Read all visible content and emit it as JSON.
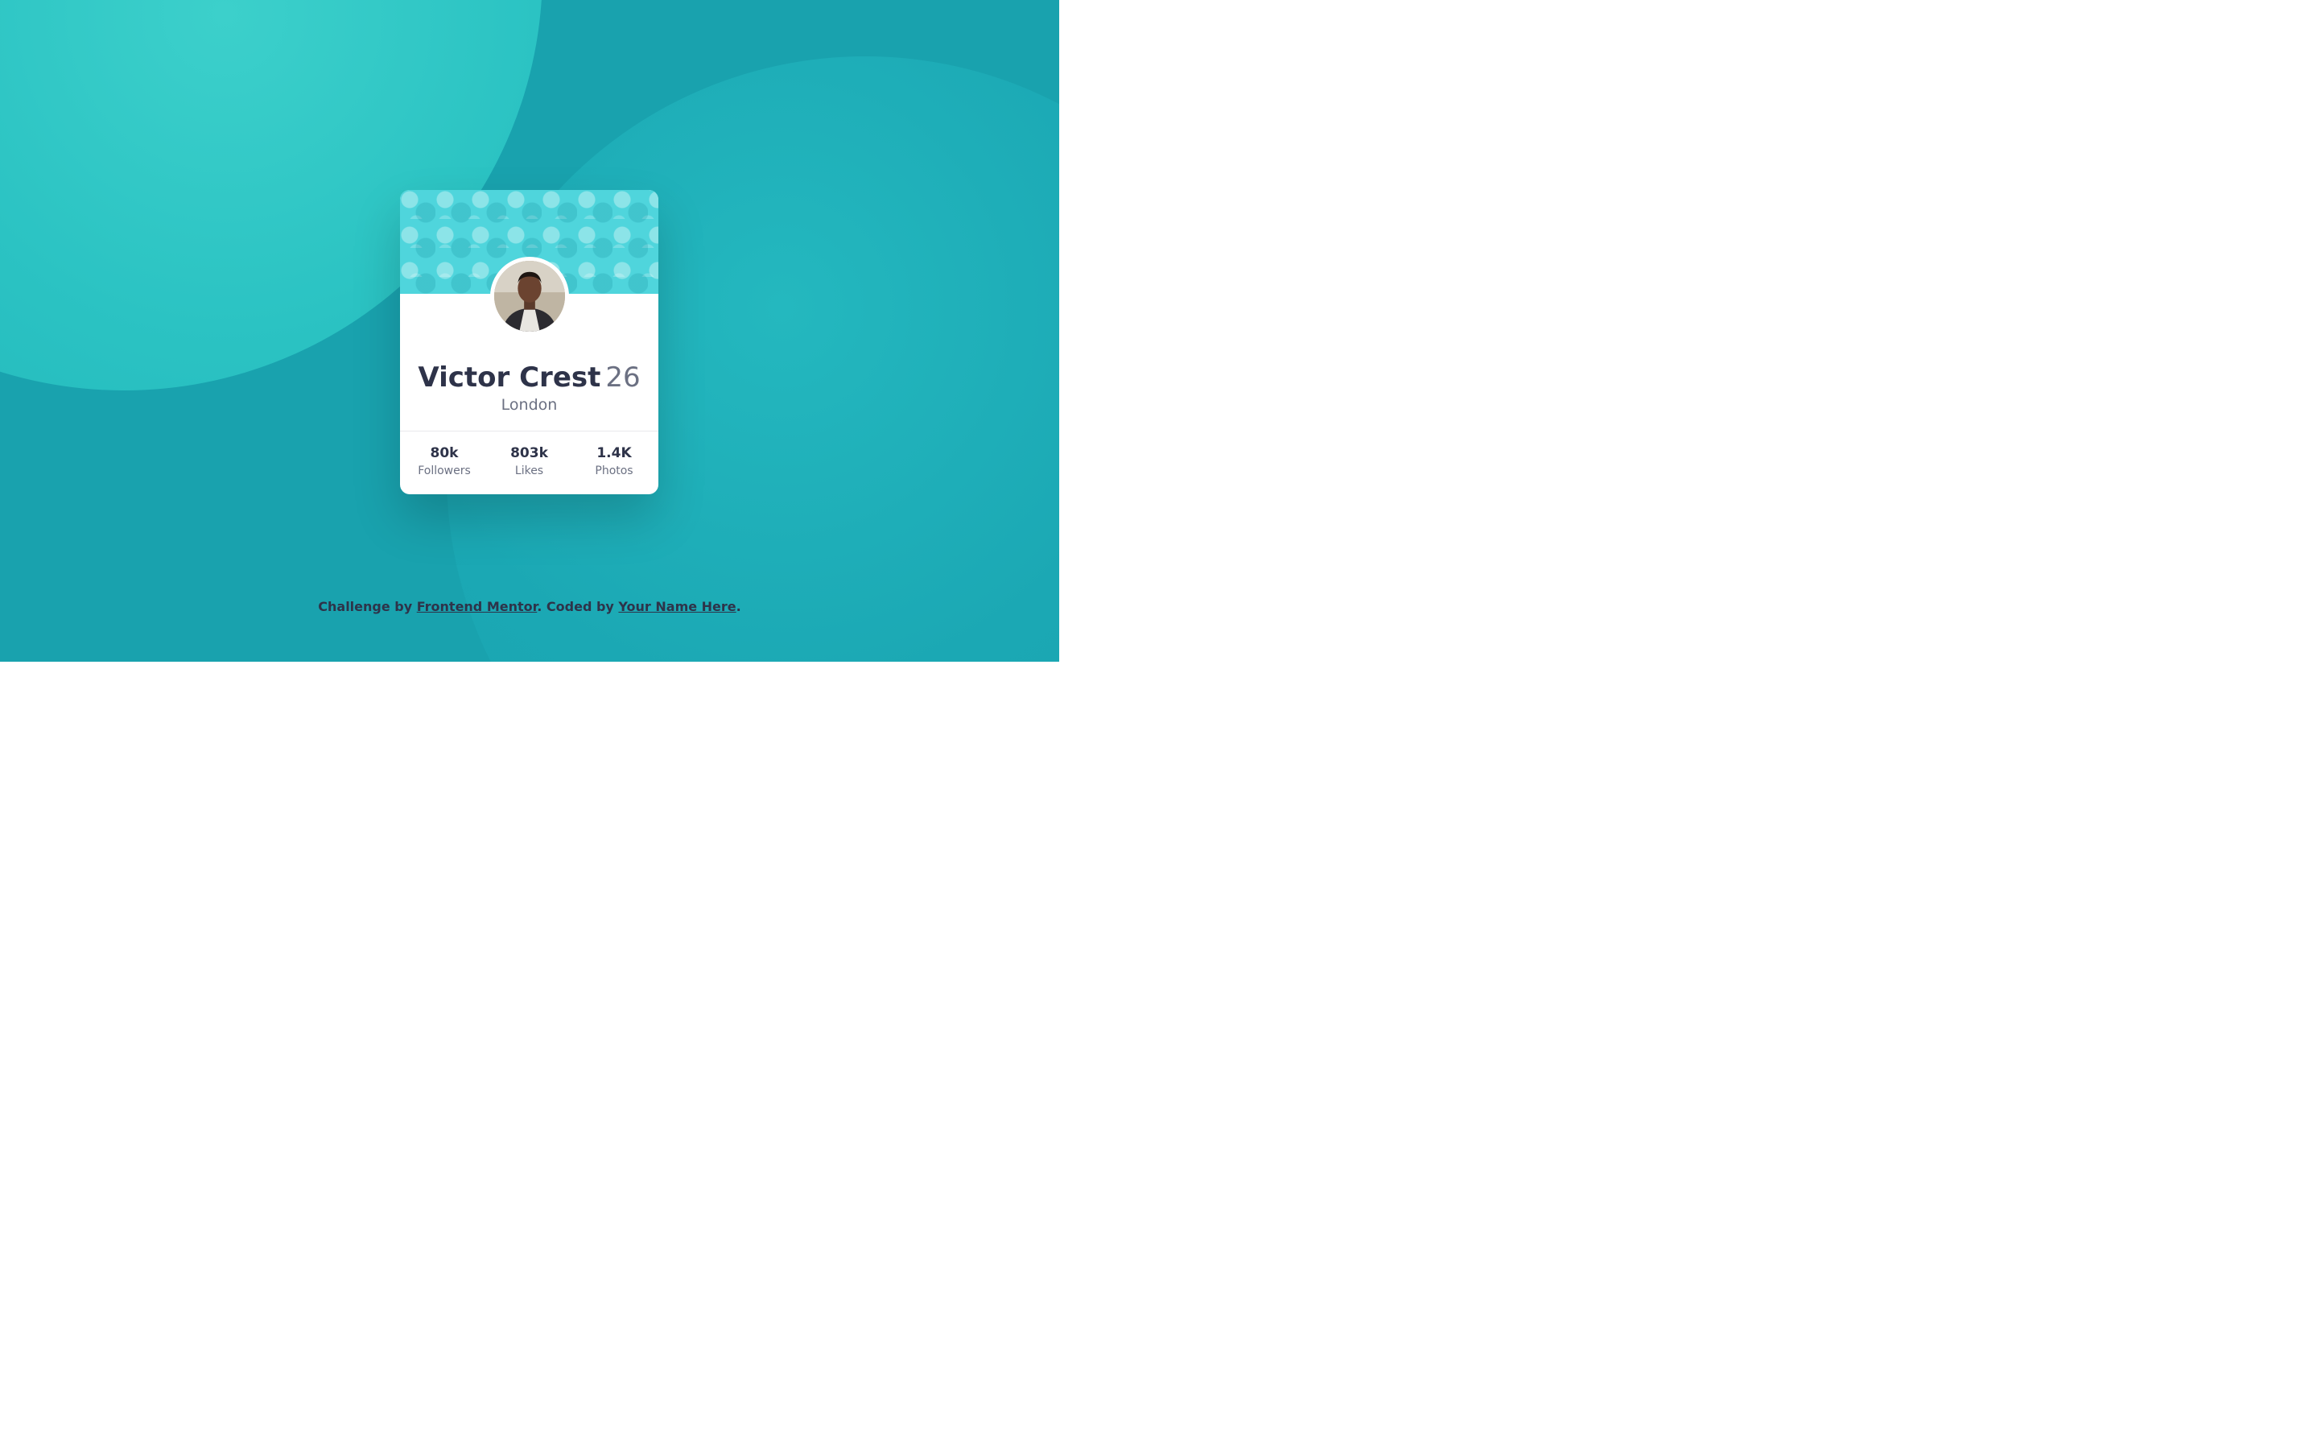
{
  "profile": {
    "name": "Victor Crest",
    "age": "26",
    "city": "London",
    "avatar_icon": "person-avatar-icon"
  },
  "stats": [
    {
      "value": "80k",
      "label": "Followers"
    },
    {
      "value": "803k",
      "label": "Likes"
    },
    {
      "value": "1.4K",
      "label": "Photos"
    }
  ],
  "attribution": {
    "prefix": "Challenge by ",
    "link1": "Frontend Mentor",
    "middle": ". Coded by ",
    "link2": "Your Name Here",
    "suffix": "."
  },
  "colors": {
    "background": "#19a2ae",
    "card": "#ffffff",
    "text_dark": "#2e3349",
    "text_gray": "#6b7082"
  }
}
